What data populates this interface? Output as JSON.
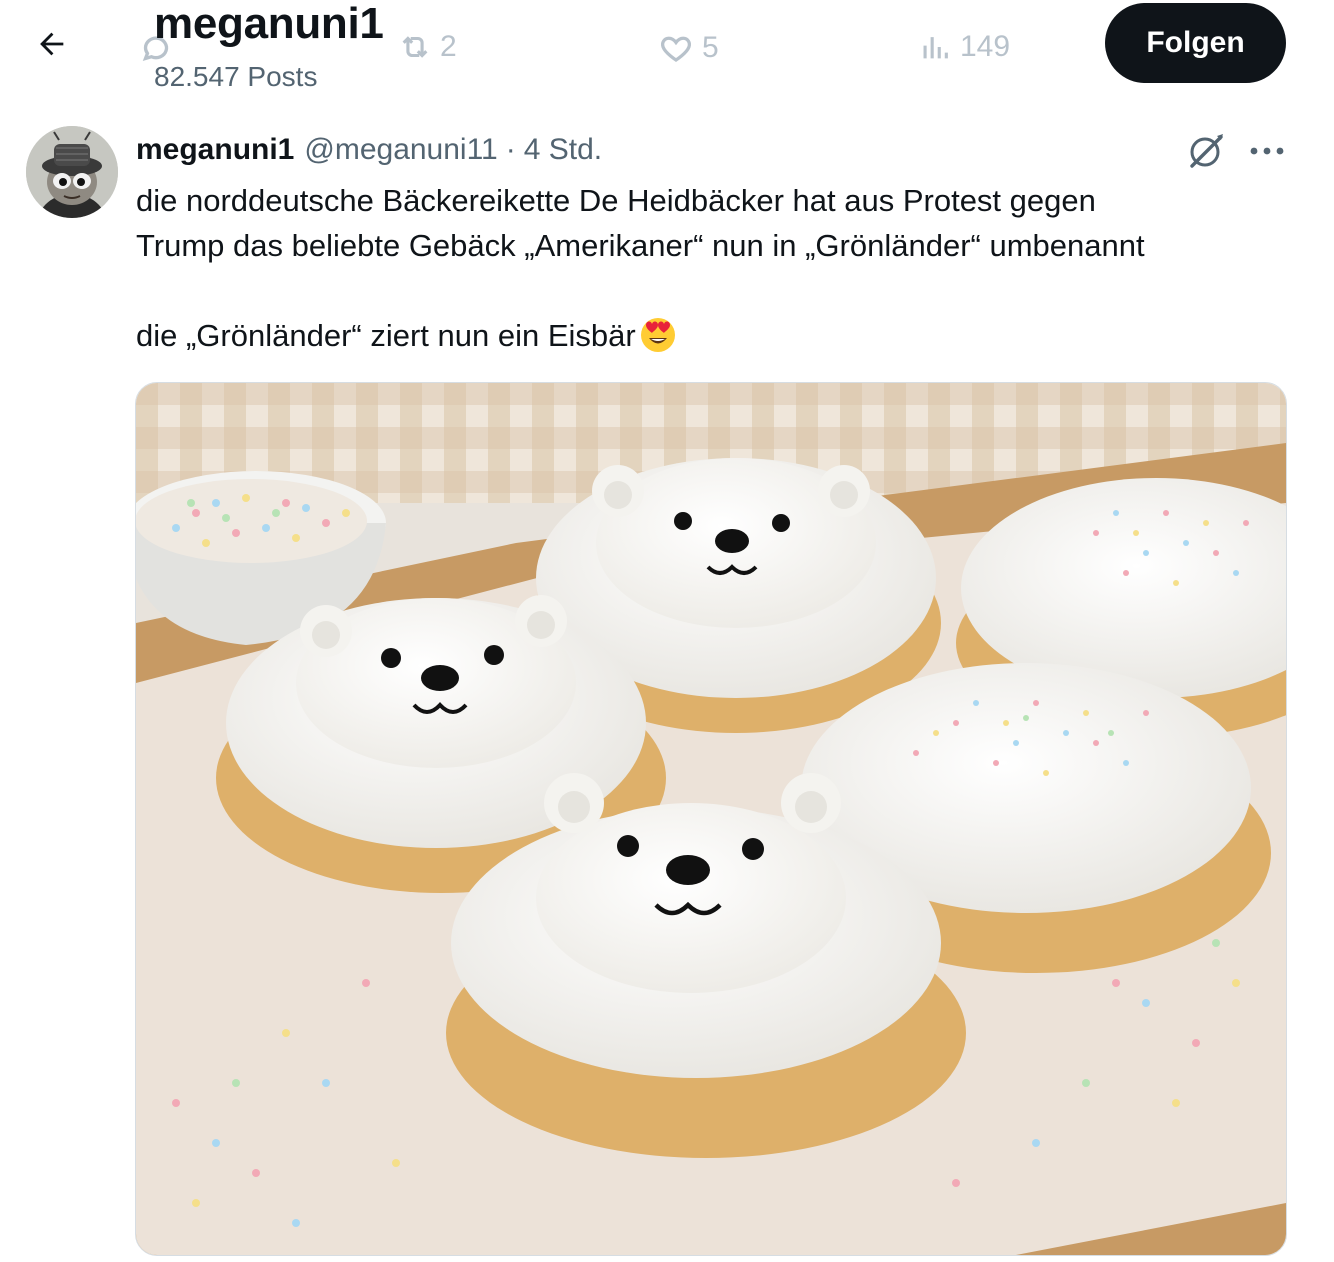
{
  "header": {
    "title": "meganuni1",
    "post_count": "82.547 Posts",
    "follow_label": "Folgen"
  },
  "background_actions": {
    "retweets": "2",
    "likes": "5",
    "views": "149"
  },
  "tweet": {
    "display_name": "meganuni1",
    "handle": "@meganuni11",
    "separator": "·",
    "time": "4 Std.",
    "text_line1": "die norddeutsche Bäckereikette De Heidbäcker hat aus Protest gegen",
    "text_line2": "Trump das beliebte Gebäck „Amerikaner“ nun in „Grönländer“ umbenannt",
    "text_line3": "die „Grönländer“ ziert nun ein Eisbär",
    "emoji": "smiling-face-with-heart-eyes"
  },
  "icons": {
    "back": "arrow-left-icon",
    "grok": "grok-icon",
    "more": "more-icon"
  },
  "colors": {
    "follow_bg": "#0f1419",
    "secondary_text": "#536471",
    "faded_actions": "#b8c2cb"
  }
}
